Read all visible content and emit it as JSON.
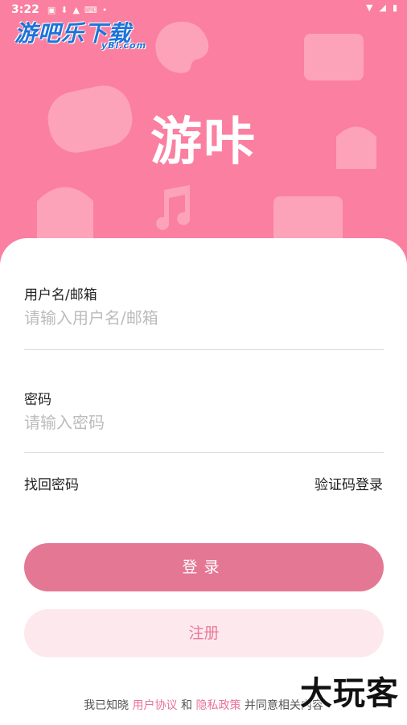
{
  "status_bar": {
    "time": "3:22"
  },
  "watermark_top": {
    "brand": "游吧乐下载",
    "domain": "yBl.com"
  },
  "app": {
    "title": "游咔"
  },
  "form": {
    "username": {
      "label": "用户名/邮箱",
      "placeholder": "请输入用户名/邮箱"
    },
    "password": {
      "label": "密码",
      "placeholder": "请输入密码"
    },
    "forgot_password": "找回密码",
    "sms_login": "验证码登录",
    "login_button": "登录",
    "register_button": "注册"
  },
  "agreement": {
    "prefix": "我已知晓",
    "user_agreement": "用户协议",
    "and": "和",
    "privacy_policy": "隐私政策",
    "suffix": "并同意相关内容"
  },
  "watermark_bottom": {
    "text": "大玩客"
  },
  "colors": {
    "hero_bg": "#fb7fa0",
    "login_btn": "#e47894",
    "register_btn": "#fde9ed",
    "link_pink": "#e8729b"
  }
}
